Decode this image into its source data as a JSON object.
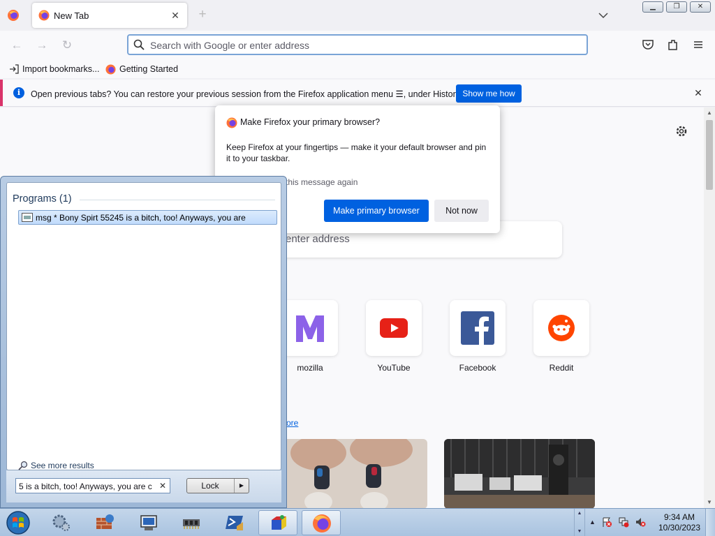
{
  "browser": {
    "tab_title": "New Tab",
    "url_placeholder": "Search with Google or enter address",
    "bookmarks": [
      "Import bookmarks...",
      "Getting Started"
    ]
  },
  "notification": {
    "message": "Open previous tabs? You can restore your previous session from the Firefox application menu ☰, under History.",
    "button": "Show me how"
  },
  "newtab": {
    "search_placeholder": "enter address",
    "shortcuts": [
      {
        "label": "mozilla",
        "icon": "mozilla-icon"
      },
      {
        "label": "YouTube",
        "icon": "youtube-icon"
      },
      {
        "label": "Facebook",
        "icon": "facebook-icon"
      },
      {
        "label": "Reddit",
        "icon": "reddit-icon"
      }
    ],
    "more_link": "ore"
  },
  "dialog": {
    "title": "Make Firefox your primary browser?",
    "body": "Keep Firefox at your fingertips — make it your default browser and pin it to your taskbar.",
    "checkbox_label": "this message again",
    "primary_button": "Make primary browser",
    "secondary_button": "Not now"
  },
  "startmenu": {
    "heading": "Programs (1)",
    "result": "msg * Bony Spirt 55245 is a bitch, too! Anyways, you are",
    "see_more": "See more results",
    "search_value": "5 is a bitch, too! Anyways, you are c",
    "lock_button": "Lock"
  },
  "taskbar": {
    "time": "9:34 AM",
    "date": "10/30/2023"
  },
  "colors": {
    "firefox_blue": "#0061e0",
    "notice_accent": "#d9346a",
    "taskbar_top": "#c4d6ea"
  }
}
